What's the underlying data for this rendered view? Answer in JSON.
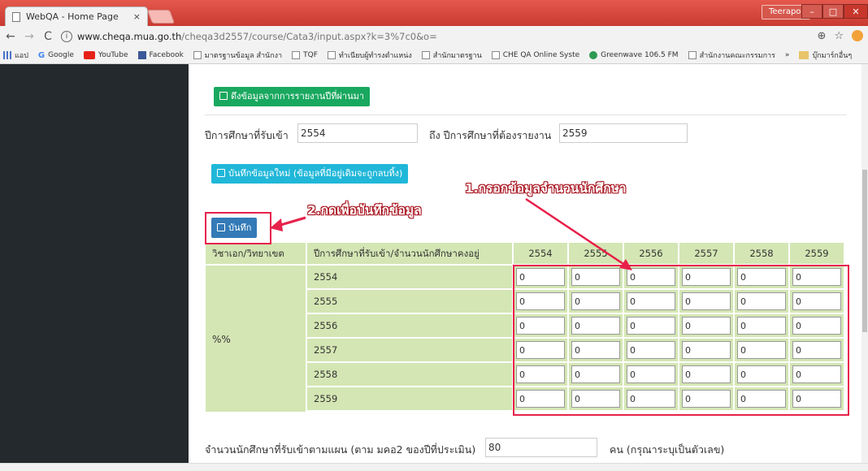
{
  "browser": {
    "tab_title": "WebQA - Home Page",
    "tab_close": "×",
    "user_badge": "Teerapol",
    "url_host": "www.cheqa.mua.go.th",
    "url_path": "/cheqa3d2557/course/Cata3/input.aspx?k=3%7c0&o=",
    "bookmarks": [
      "แอป",
      "Google",
      "YouTube",
      "Facebook",
      "มาตรฐานข้อมูล สำนักงา",
      "TQF",
      "ทำเนียบผู้ทำรงตำแหน่ง",
      "สำนักมาตรฐาน",
      "CHE QA Online Syste",
      "Greenwave 106.5 FM",
      "สำนักงานคณะกรรมการ"
    ],
    "bookmarks_more": "»",
    "other_bookmarks": "บุ๊กมาร์กอื่นๆ"
  },
  "page": {
    "pull_prev_button": "ดึงข้อมูลจากการรายงานปีที่ผ่านมา",
    "year_start_label": "ปีการศึกษาที่รับเข้า",
    "year_start_value": "2554",
    "year_end_label": "ถึง ปีการศึกษาที่ต้องรายงาน",
    "year_end_value": "2559",
    "save_new_button": "บันทึกข้อมูลใหม่ (ข้อมูลที่มีอยู่เดิมจะถูกลบทิ้ง)",
    "save_button": "บันทึก",
    "plan_label": "จำนวนนักศึกษาที่รับเข้าตามแผน (ตาม มคอ2 ของปีที่ประเมิน)",
    "plan_value": "80",
    "plan_unit": "คน (กรุณาระบุเป็นตัวเลข)"
  },
  "table": {
    "col_major": "วิชาเอก/วิทยาเขต",
    "col_year": "ปีการศึกษาที่รับเข้า/จำนวนนักศึกษาคงอยู่",
    "years": [
      "2554",
      "2555",
      "2556",
      "2557",
      "2558",
      "2559"
    ],
    "major_value": "%%",
    "cell_value": "0"
  },
  "annotations": {
    "step1": "1.กรอกข้อมูลจำนวนนักศึกษา",
    "step2": "2.กดเพื่อบันทึกข้อมูล"
  },
  "colors": {
    "accent_red": "#e7214a",
    "table_green": "#d4e6b4",
    "save_blue": "#337ab7"
  }
}
